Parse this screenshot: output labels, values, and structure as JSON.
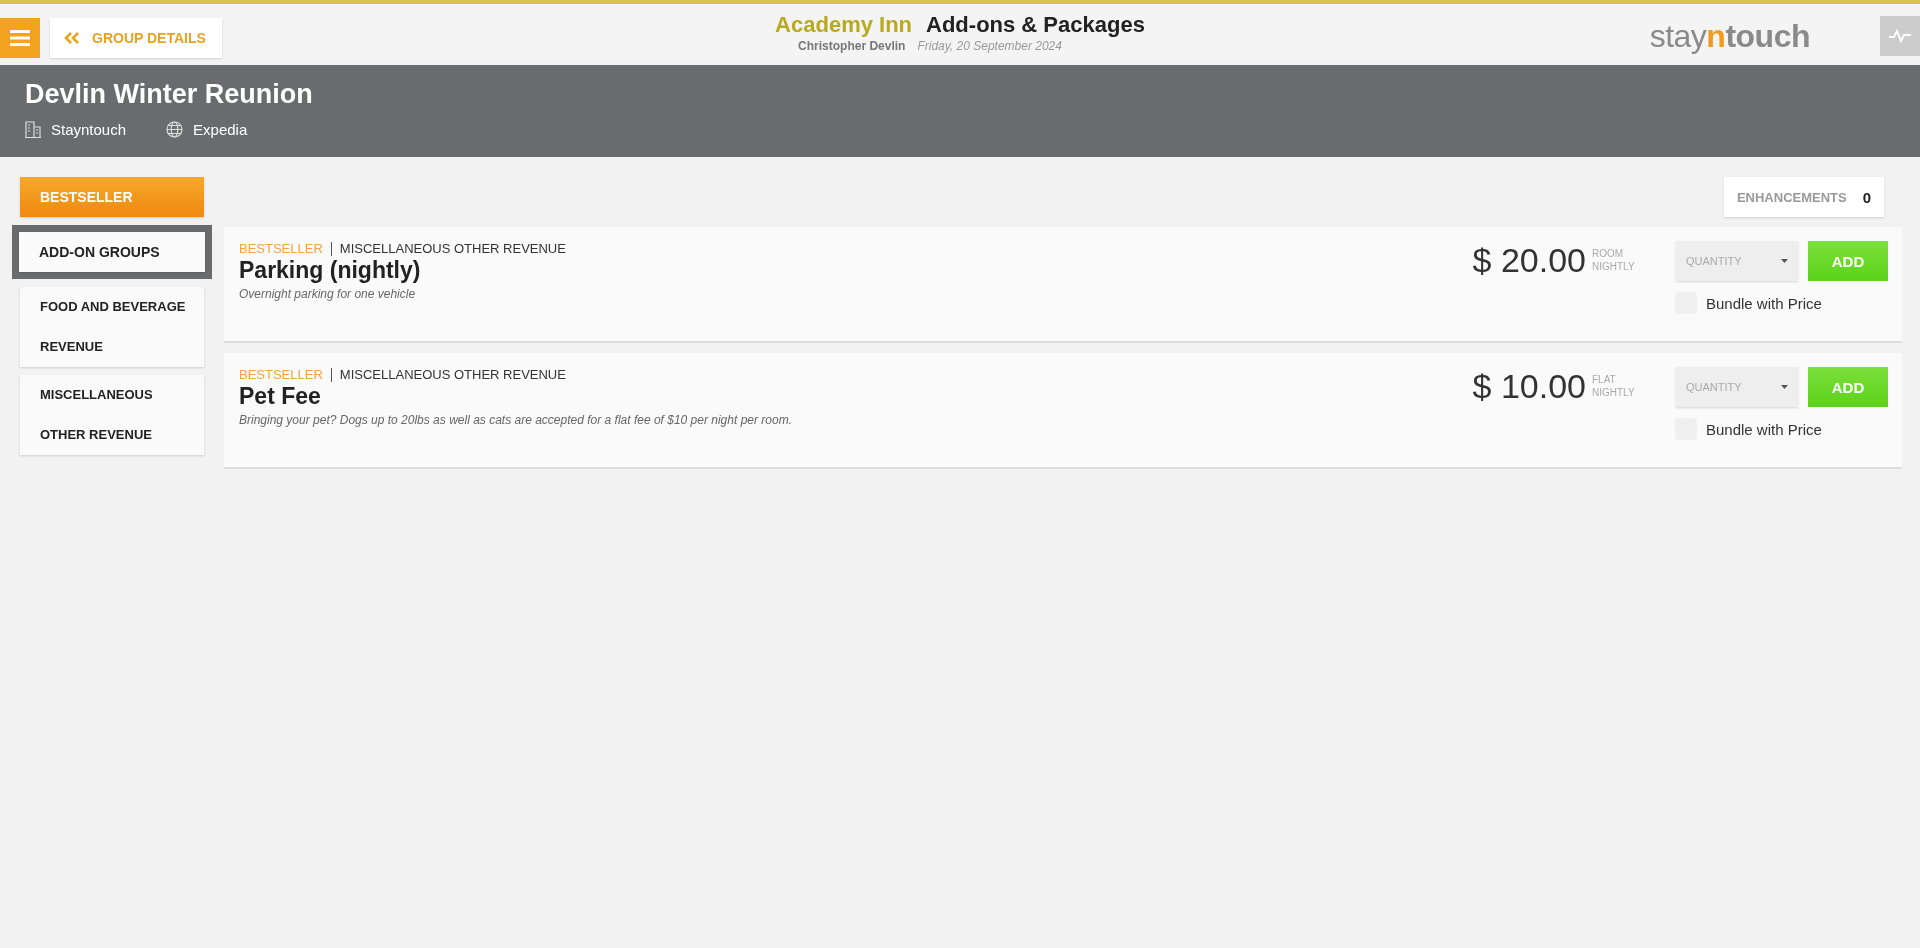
{
  "header": {
    "back_button": "GROUP DETAILS",
    "hotel": "Academy Inn",
    "page_title": "Add-ons & Packages",
    "user": "Christopher Devlin",
    "date": "Friday, 20 September 2024",
    "logo": {
      "part_1": "stay",
      "part_2": "n",
      "part_3": "touch"
    }
  },
  "group": {
    "name": "Devlin Winter Reunion",
    "company": "Stayntouch",
    "source": "Expedia"
  },
  "sidebar": {
    "items": [
      {
        "label": "BESTSELLER",
        "selected": true,
        "highlighted": false
      },
      {
        "label": "ADD-ON GROUPS",
        "selected": false,
        "highlighted": true
      },
      {
        "label": "FOOD AND BEVERAGE REVENUE",
        "selected": false,
        "highlighted": false
      },
      {
        "label": "MISCELLANEOUS OTHER REVENUE",
        "selected": false,
        "highlighted": false
      }
    ]
  },
  "enhancements": {
    "label": "ENHANCEMENTS",
    "count": "0"
  },
  "addons": [
    {
      "tag": "BESTSELLER",
      "category": "MISCELLANEOUS OTHER REVENUE",
      "name": "Parking (nightly)",
      "description": "Overnight parking for one vehicle",
      "price": "$ 20.00",
      "price_type_1": "ROOM",
      "price_type_2": "NIGHTLY",
      "quantity_placeholder": "QUANTITY",
      "button": "ADD",
      "bundle_label": "Bundle with Price",
      "bundle_checked": false
    },
    {
      "tag": "BESTSELLER",
      "category": "MISCELLANEOUS OTHER REVENUE",
      "name": "Pet Fee",
      "description": "Bringing your pet? Dogs up to 20lbs as well as cats are accepted for a flat fee of $10 per night per room.",
      "price": "$ 10.00",
      "price_type_1": "FLAT",
      "price_type_2": "NIGHTLY",
      "quantity_placeholder": "QUANTITY",
      "button": "ADD",
      "bundle_label": "Bundle with Price",
      "bundle_checked": false
    }
  ]
}
